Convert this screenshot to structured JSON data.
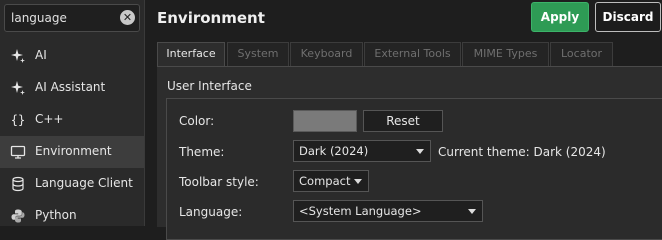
{
  "search": {
    "value": "language"
  },
  "sidebar": {
    "items": [
      {
        "label": "AI",
        "icon": "sparkle-icon"
      },
      {
        "label": "AI Assistant",
        "icon": "sparkle-icon"
      },
      {
        "label": "C++",
        "icon": "braces-icon"
      },
      {
        "label": "Environment",
        "icon": "monitor-icon",
        "selected": true
      },
      {
        "label": "Language Client",
        "icon": "database-icon"
      },
      {
        "label": "Python",
        "icon": "python-icon"
      }
    ]
  },
  "header": {
    "title": "Environment",
    "apply_label": "Apply",
    "discard_label": "Discard"
  },
  "tabs": [
    {
      "label": "Interface",
      "active": true
    },
    {
      "label": "System"
    },
    {
      "label": "Keyboard"
    },
    {
      "label": "External Tools"
    },
    {
      "label": "MIME Types"
    },
    {
      "label": "Locator"
    }
  ],
  "interface": {
    "group_title": "User Interface",
    "color_label": "Color:",
    "reset_label": "Reset",
    "theme_label": "Theme:",
    "theme_value": "Dark (2024)",
    "current_theme": "Current theme: Dark (2024)",
    "toolbar_label": "Toolbar style:",
    "toolbar_value": "Compact",
    "language_label": "Language:",
    "language_value": "<System Language>"
  },
  "colors": {
    "apply_bg": "#2e9b55",
    "swatch": "#7a7a7a",
    "background": "#1e1e1e"
  }
}
